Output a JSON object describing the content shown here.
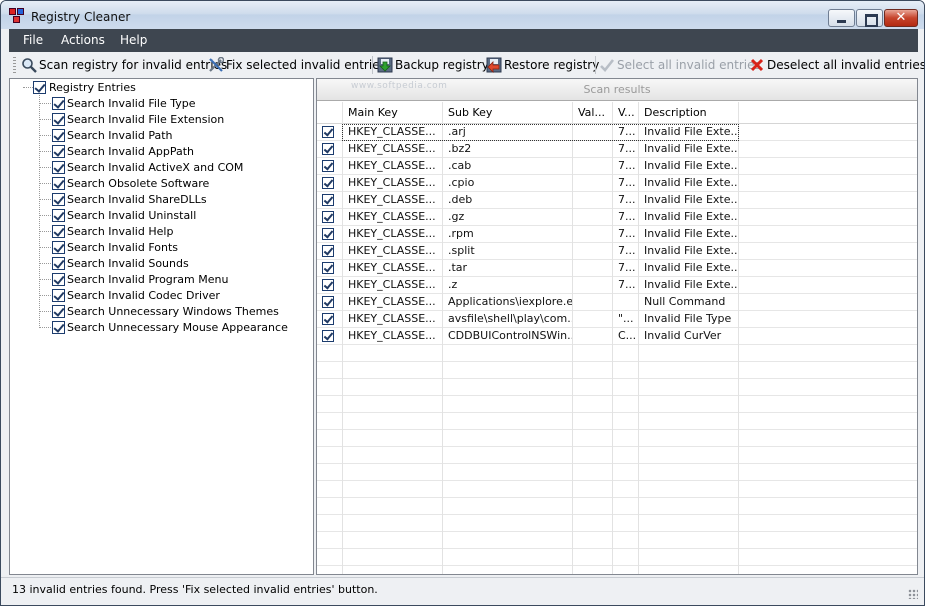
{
  "window": {
    "title": "Registry Cleaner"
  },
  "menu": [
    "File",
    "Actions",
    "Help"
  ],
  "toolbar": {
    "scan": "Scan registry for invalid entries",
    "fix": "Fix selected invalid entries",
    "backup": "Backup registry",
    "restore": "Restore registry",
    "select_all": "Select all invalid entries",
    "deselect_all": "Deselect all invalid entries"
  },
  "tree": {
    "root": "Registry Entries",
    "items": [
      "Search Invalid File Type",
      "Search Invalid File Extension",
      "Search Invalid Path",
      "Search Invalid AppPath",
      "Search Invalid ActiveX and COM",
      "Search Obsolete Software",
      "Search Invalid ShareDLLs",
      "Search Invalid Uninstall",
      "Search Invalid Help",
      "Search Invalid Fonts",
      "Search Invalid Sounds",
      "Search Invalid Program Menu",
      "Search Invalid Codec Driver",
      "Search Unnecessary Windows Themes",
      "Search Unnecessary Mouse Appearance"
    ]
  },
  "results": {
    "caption": "Scan results",
    "columns": [
      "Main Key",
      "Sub Key",
      "Val...",
      "V...",
      "Description"
    ],
    "rows": [
      [
        "HKEY_CLASSE...",
        ".arj",
        "",
        "7...",
        "Invalid File Exte..."
      ],
      [
        "HKEY_CLASSE...",
        ".bz2",
        "",
        "7...",
        "Invalid File Exte..."
      ],
      [
        "HKEY_CLASSE...",
        ".cab",
        "",
        "7...",
        "Invalid File Exte..."
      ],
      [
        "HKEY_CLASSE...",
        ".cpio",
        "",
        "7...",
        "Invalid File Exte..."
      ],
      [
        "HKEY_CLASSE...",
        ".deb",
        "",
        "7...",
        "Invalid File Exte..."
      ],
      [
        "HKEY_CLASSE...",
        ".gz",
        "",
        "7...",
        "Invalid File Exte..."
      ],
      [
        "HKEY_CLASSE...",
        ".rpm",
        "",
        "7...",
        "Invalid File Exte..."
      ],
      [
        "HKEY_CLASSE...",
        ".split",
        "",
        "7...",
        "Invalid File Exte..."
      ],
      [
        "HKEY_CLASSE...",
        ".tar",
        "",
        "7...",
        "Invalid File Exte..."
      ],
      [
        "HKEY_CLASSE...",
        ".z",
        "",
        "7...",
        "Invalid File Exte..."
      ],
      [
        "HKEY_CLASSE...",
        "Applications\\iexplore.e...",
        "",
        "",
        "Null Command"
      ],
      [
        "HKEY_CLASSE...",
        "avsfile\\shell\\play\\com...",
        "",
        "\"...",
        "Invalid File Type"
      ],
      [
        "HKEY_CLASSE...",
        "CDDBUIControlNSWin...",
        "",
        "C...",
        "Invalid CurVer"
      ]
    ]
  },
  "status": {
    "text": "13 invalid entries found. Press 'Fix selected invalid entries' button."
  },
  "watermark": "www.softpedia.com"
}
